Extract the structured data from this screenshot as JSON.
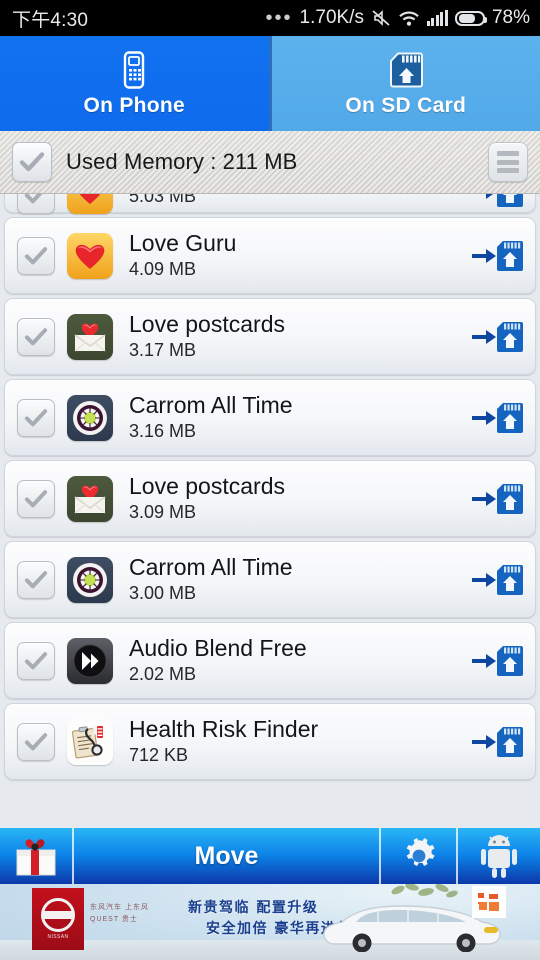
{
  "statusbar": {
    "clock": "下午4:30",
    "dots": "•••",
    "network_speed": "1.70K/s",
    "battery_percent": "78%",
    "icons": [
      "overflow-dots-icon",
      "mute-icon",
      "wifi-icon",
      "signal-bars-icon",
      "battery-icon"
    ]
  },
  "tabs": [
    {
      "label": "On Phone",
      "icon": "phone-icon",
      "active": true
    },
    {
      "label": "On SD Card",
      "icon": "sd-card-icon",
      "active": false
    }
  ],
  "header": {
    "checkbox_checked": true,
    "used_memory_label": "Used Memory : 211 MB",
    "sort_icon": "list-sort-icon"
  },
  "apps": [
    {
      "name": "",
      "size": "5.03 MB",
      "icon": "heart-yellow-icon",
      "checked": true,
      "clipped": true,
      "action_icon": "move-to-sd-icon"
    },
    {
      "name": "Love Guru",
      "size": "4.09 MB",
      "icon": "heart-yellow-icon",
      "checked": true,
      "clipped": false,
      "action_icon": "move-to-sd-icon"
    },
    {
      "name": "Love postcards",
      "size": "3.17 MB",
      "icon": "envelope-heart-olive-icon",
      "checked": true,
      "clipped": false,
      "action_icon": "move-to-sd-icon"
    },
    {
      "name": "Carrom All Time",
      "size": "3.16 MB",
      "icon": "carrom-board-icon",
      "checked": true,
      "clipped": false,
      "action_icon": "move-to-sd-icon"
    },
    {
      "name": "Love postcards",
      "size": "3.09 MB",
      "icon": "envelope-heart-olive-icon",
      "checked": true,
      "clipped": false,
      "action_icon": "move-to-sd-icon"
    },
    {
      "name": "Carrom All Time",
      "size": "3.00 MB",
      "icon": "carrom-board-icon",
      "checked": true,
      "clipped": false,
      "action_icon": "move-to-sd-icon"
    },
    {
      "name": "Audio Blend Free",
      "size": "2.02 MB",
      "icon": "audio-play-icon",
      "checked": true,
      "clipped": false,
      "action_icon": "move-to-sd-icon"
    },
    {
      "name": "Health Risk Finder",
      "size": "712 KB",
      "icon": "clipboard-stethoscope-icon",
      "checked": true,
      "clipped": false,
      "action_icon": "move-to-sd-icon"
    }
  ],
  "bottombar": {
    "gift_icon": "gift-box-icon",
    "move_label": "Move",
    "settings_icon": "gear-icon",
    "apps_icon": "android-robot-icon"
  },
  "ad": {
    "brand": "NISSAN",
    "brand_sub_line1": "东风汽车 上东风",
    "brand_sub_line2": "QUEST 贵士",
    "headline_line1": "新贵驾临  配置升级",
    "headline_line2": "安全加倍  豪华再进化",
    "badge_icon": "ad-network-badge-icon"
  },
  "colors": {
    "tab_active": "#1172f0",
    "tab_inactive": "#57aeeb",
    "move_bar_top": "#29b6f6",
    "move_bar_bottom": "#0b38a8",
    "sd_icon_blue": "#1565c0",
    "status_bar": "#000000"
  }
}
